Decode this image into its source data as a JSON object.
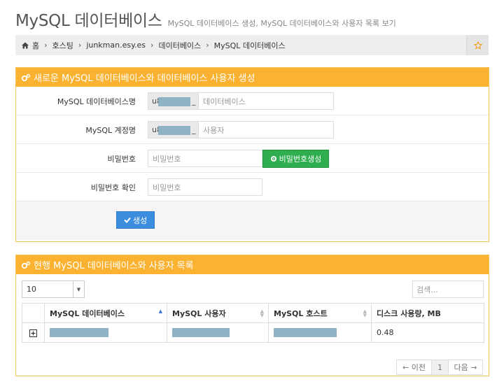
{
  "header": {
    "title": "MySQL 데이터베이스",
    "subtitle": "MySQL 데이터베이스 생성, MySQL 데이터베이스와 사용자 목록 보기"
  },
  "breadcrumb": [
    "홈",
    "호스팅",
    "junkman.esy.es",
    "데이터베이스",
    "MySQL 데이터베이스"
  ],
  "create_panel": {
    "title": "새로운 MySQL 데이터베이스와 데이터베이스 사용자 생성",
    "db_name_label": "MySQL 데이터베이스명",
    "db_prefix": "u8",
    "db_prefix_suffix": "_",
    "db_name_placeholder": "데이터베이스",
    "user_label": "MySQL 계정명",
    "user_prefix": "u8",
    "user_prefix_suffix": "_",
    "user_placeholder": "사용자",
    "password_label": "비밀번호",
    "password_placeholder": "비밀번호",
    "generate_button": "비밀번호생성",
    "confirm_label": "비밀번호 확인",
    "confirm_placeholder": "비밀번호",
    "submit_button": "생성"
  },
  "list_panel": {
    "title": "현행 MySQL 데이터베이스와 사용자 목록",
    "page_size": "10",
    "search_placeholder": "검색...",
    "columns": [
      "MySQL 데이터베이스",
      "MySQL 사용자",
      "MySQL 호스트",
      "디스크 사용량, MB"
    ],
    "rows": [
      {
        "disk_usage": "0.48"
      }
    ],
    "pager": {
      "prev": "← 이전",
      "page": "1",
      "next": "다음 →"
    }
  },
  "colors": {
    "panel_header": "#fbb231",
    "primary_button": "#3c8dde",
    "success_button": "#2eae4e",
    "redaction": "#8fb3c4"
  },
  "icons": [
    "home-icon",
    "star-icon",
    "cogs-icon",
    "gear-icon",
    "check-icon",
    "plus-square-icon",
    "sort-icon"
  ]
}
